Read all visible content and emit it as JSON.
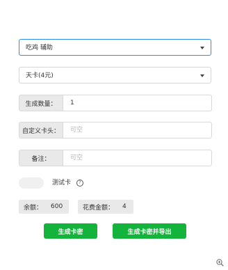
{
  "selects": {
    "mode": "吃鸡 辅助",
    "card_type": "天卡(4元)"
  },
  "fields": {
    "quantity": {
      "label": "生成数量：",
      "value": "1"
    },
    "prefix": {
      "label": "自定义卡头：",
      "placeholder": "可空"
    },
    "remark": {
      "label": "备注：",
      "placeholder": "可空"
    }
  },
  "test_card": {
    "label": "测试卡",
    "help_glyph": "?"
  },
  "stats": {
    "balance_label": "余额：",
    "balance_value": "600",
    "cost_label": "花费金额：",
    "cost_value": "4"
  },
  "buttons": {
    "generate": "生成卡密",
    "generate_export": "生成卡密并导出"
  }
}
